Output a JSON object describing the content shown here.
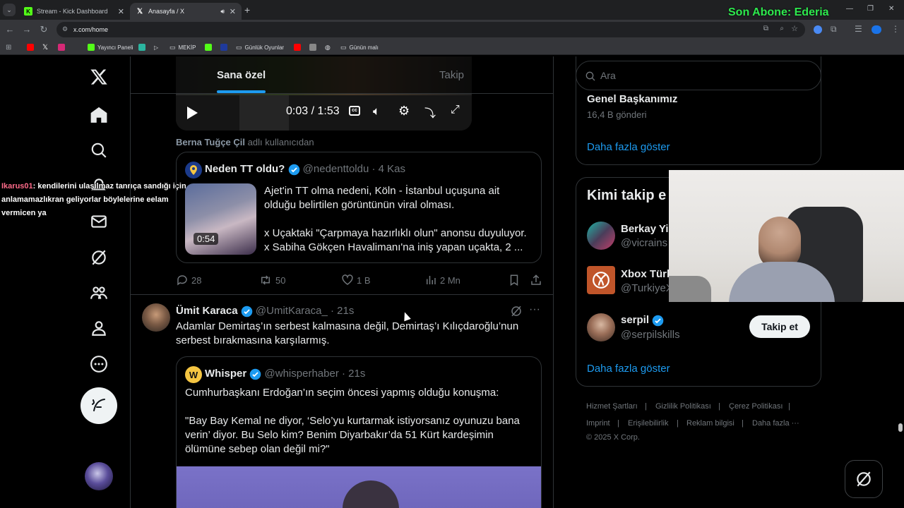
{
  "browser": {
    "tabs": [
      {
        "title": "Stream - Kick Dashboard"
      },
      {
        "title": "Anasayfa / X"
      }
    ],
    "overlay_text": "Son Abone: Ederia",
    "url": "x.com/home",
    "bookmarks": [
      "Yayıncı Paneli",
      "MEKİP",
      "Günlük Oyunlar",
      "Günün malı"
    ]
  },
  "feed": {
    "tabs": [
      "Sana özel",
      "Takip"
    ],
    "video": {
      "time": "0:03 / 1:53"
    },
    "social_context": {
      "name": "Berna Tuğçe Çil",
      "suffix": "adlı kullanıcıdan"
    },
    "quoted1": {
      "name": "Neden TT oldu?",
      "handle": "@nedenttoldu",
      "date": "4 Kas",
      "duration": "0:54",
      "text1": "Ajet'in TT olma nedeni, Köln - İstanbul uçuşuna ait",
      "text2": "olduğu belirtilen görüntünün viral olması.",
      "text3": "x Uçaktaki \"Çarpmaya hazırlıklı olun\" anonsu duyuluyor.",
      "text4": "x Sabiha Gökçen Havalimanı'na iniş yapan uçakta, 2 ..."
    },
    "actions": {
      "replies": "28",
      "reposts": "50",
      "likes": "1 B",
      "views": "2 Mn"
    },
    "post2": {
      "name": "Ümit Karaca",
      "handle": "@UmitKaraca_",
      "time": "21s",
      "text1": "Adamlar Demirtaş’ın serbest kalmasına değil, Demirtaş’ı Kılıçdaroğlu’nun",
      "text2": "serbest bırakmasına karşılarmış."
    },
    "quoted2": {
      "name": "Whisper",
      "handle": "@whisperhaber",
      "time": "21s",
      "text1": "Cumhurbaşkanı Erdoğan’ın seçim öncesi yapmış olduğu konuşma:",
      "text2": "\"Bay Bay Kemal ne diyor, ‘Selo’yu kurtarmak istiyorsanız oyunuzu bana",
      "text3": "verin’ diyor. Bu Selo kim? Benim Diyarbakır’da 51 Kürt kardeşimin",
      "text4": "ölümüne sebep olan değil mi?\""
    }
  },
  "chat_overlay": {
    "user": "Ikarus01",
    "line1": ": kendilerini ulaşılmaz tanrıça sandığı için",
    "line2": "anlamamazlıkran geliyorlar böylelerine eelam",
    "line3": "vermicen ya"
  },
  "sidebar": {
    "search_placeholder": "Ara",
    "trend": {
      "title": "Genel Başkanımız",
      "count": "16,4 B gönderi"
    },
    "show_more": "Daha fazla göster",
    "who_to_follow": {
      "title": "Kimi takip e",
      "users": [
        {
          "name": "Berkay Yi",
          "handle": "@vicrains"
        },
        {
          "name": "Xbox Türk",
          "handle": "@TurkiyeX"
        },
        {
          "name": "serpil",
          "handle": "@serpilskills"
        }
      ],
      "follow_label": "Takip et",
      "show_more": "Daha fazla göster"
    },
    "footer": {
      "l1": "Hizmet Şartları",
      "l2": "Gizlilik Politikası",
      "l3": "Çerez Politikası",
      "l4": "Imprint",
      "l5": "Erişilebilirlik",
      "l6": "Reklam bilgisi",
      "l7": "Daha fazla ···",
      "copyright": "© 2025 X Corp."
    }
  }
}
